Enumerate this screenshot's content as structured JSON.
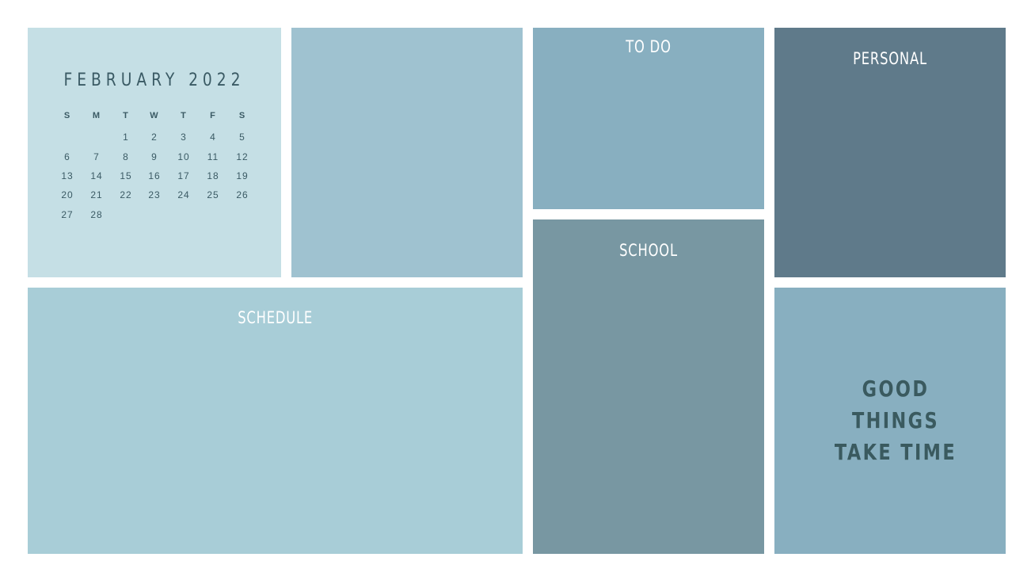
{
  "colors": {
    "calendar_bg": "#c5dfe5",
    "blank_bg": "#9fc2d0",
    "todo_bg": "#88afc0",
    "personal_bg": "#5f7a8a",
    "schedule_bg": "#a8cdd7",
    "school_bg": "#7897a2",
    "quote_bg": "#88afc0",
    "dark_text": "#3a5a64",
    "light_text": "#ffffff"
  },
  "calendar": {
    "title": "FEBRUARY 2022",
    "weekdays": [
      "S",
      "M",
      "T",
      "W",
      "T",
      "F",
      "S"
    ],
    "weeks": [
      [
        "",
        "",
        "1",
        "2",
        "3",
        "4",
        "5"
      ],
      [
        "6",
        "7",
        "8",
        "9",
        "10",
        "11",
        "12"
      ],
      [
        "13",
        "14",
        "15",
        "16",
        "17",
        "18",
        "19"
      ],
      [
        "20",
        "21",
        "22",
        "23",
        "24",
        "25",
        "26"
      ],
      [
        "27",
        "28",
        "",
        "",
        "",
        "",
        ""
      ]
    ]
  },
  "panels": {
    "todo": "TO DO",
    "personal": "PERSONAL",
    "schedule": "SCHEDULE",
    "school": "SCHOOL"
  },
  "quote": {
    "lines": [
      "GOOD",
      "THINGS",
      "TAKE TIME"
    ]
  }
}
